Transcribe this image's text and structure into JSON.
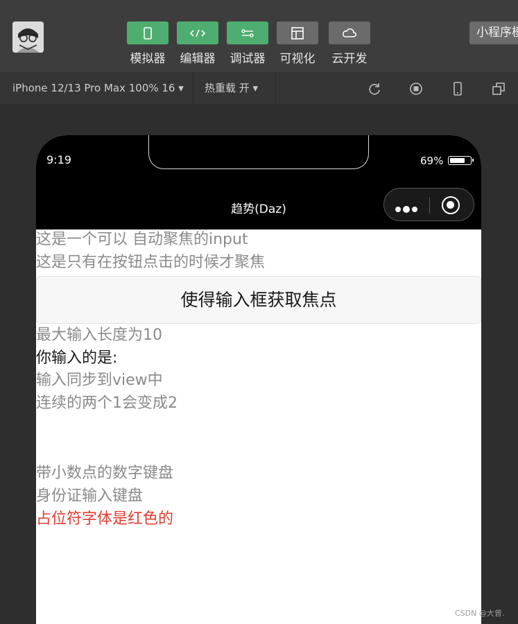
{
  "toolbar": {
    "tools": [
      {
        "label": "模拟器",
        "icon": "phone-icon"
      },
      {
        "label": "编辑器",
        "icon": "code-icon"
      },
      {
        "label": "调试器",
        "icon": "debug-icon"
      },
      {
        "label": "可视化",
        "icon": "layout-icon"
      },
      {
        "label": "云开发",
        "icon": "cloud-icon"
      }
    ],
    "mini_program": "小程序模"
  },
  "subbar": {
    "device": "iPhone 12/13 Pro Max 100% 16 ▾",
    "hot_reload": "热重载 开 ▾"
  },
  "phone": {
    "time": "9:19",
    "battery": "69%",
    "battery_level": 0.69,
    "nav_title": "趋势(Daz)"
  },
  "content": {
    "line1": "这是一个可以 自动聚焦的input",
    "line2": "这是只有在按钮点击的时候才聚焦",
    "button": "使得输入框获取焦点",
    "line3": "最大输入长度为10",
    "line4": "你输入的是:",
    "line5": "输入同步到view中",
    "line6": "连续的两个1会变成2",
    "line7": "带小数点的数字键盘",
    "line8": "身份证输入键盘",
    "line9": "占位符字体是红色的"
  },
  "watermark": "CSDN @大曾."
}
